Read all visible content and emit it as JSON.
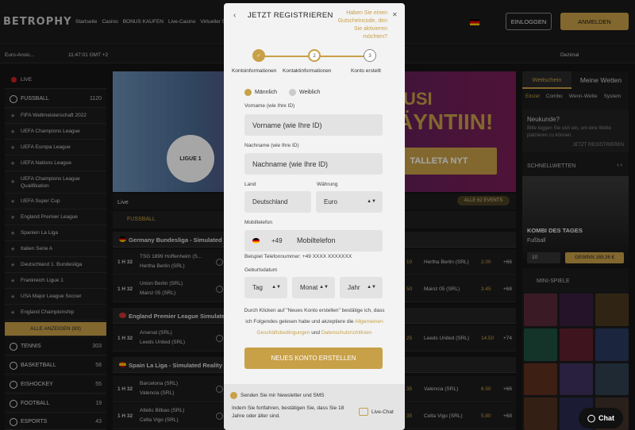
{
  "header": {
    "logo": "BETROPHY",
    "nav": [
      "Startseite",
      "Casino",
      "BONUS KAUFEN",
      "Live-Casino",
      "Virtueller Sport"
    ],
    "login_label": "EINLOGGEN",
    "register_label": "ANMELDEN"
  },
  "subbar": {
    "odds_format": "Euro-Ansic...",
    "time": "11:47:01 GMT +2",
    "decimal": "Dezimal"
  },
  "sidebar": {
    "live_label": "LIVE",
    "football": {
      "label": "FUSSBALL",
      "count": "1120"
    },
    "leagues": [
      "FIFA Weltmeisterschaft 2022",
      "UEFA Champions League",
      "UEFA Europa League",
      "UEFA Nations League",
      "UEFA Champions League Qualifikation",
      "UEFA Super Cup",
      "England Premier League",
      "Spanien La Liga",
      "Italien Serie A",
      "Deutschland 1. Bundesliga",
      "Frankreich Ligue 1",
      "USA Major League Soccer",
      "England Championship"
    ],
    "show_all": "ALLE ANZEIGEN (83)",
    "sports": [
      {
        "label": "TENNIS",
        "count": "303"
      },
      {
        "label": "BASKETBALL",
        "count": "58"
      },
      {
        "label": "EISHOCKEY",
        "count": "55"
      },
      {
        "label": "FOOTBALL",
        "count": "19"
      },
      {
        "label": "ESPORTS",
        "count": "43"
      }
    ]
  },
  "banner": {
    "line1": "USI",
    "line2": "ÄYNTIIN!",
    "button": "TALLETA NYT",
    "badge": "LIGUE 1"
  },
  "live": {
    "title": "Live",
    "all_events": "ALLE 62 EVENTS",
    "section": "FUSSBALL",
    "leagues": [
      {
        "name": "Germany Bundesliga - Simulated",
        "matches": [
          {
            "time": "1 H 32",
            "home": "TSG 1899 Hoffenheim (S...",
            "away_line": "Hertha Berlin (SRL)",
            "odd1": "10",
            "away": "Hertha Berlin (SRL)",
            "odd2": "2.00",
            "more": "+66"
          },
          {
            "time": "1 H 32",
            "home": "Union Berlin (SRL)",
            "away_line": "Mainz 05 (SRL)",
            "odd1": "50",
            "away": "Mainz 05 (SRL)",
            "odd2": "3.45",
            "more": "+68"
          }
        ]
      },
      {
        "name": "England Premier League Simulated",
        "matches": [
          {
            "time": "1 H 32",
            "home": "Arsenal (SRL)",
            "away_line": "Leeds United (SRL)",
            "odd1": "25",
            "away": "Leeds United (SRL)",
            "odd2": "14.50",
            "more": "+74"
          }
        ]
      },
      {
        "name": "Spain La Liga - Simulated Reality",
        "matches": [
          {
            "time": "1 H 32",
            "home": "Barcelona (SRL)",
            "away_line": "Valencia (SRL)",
            "odd1": "35",
            "away": "Valencia (SRL)",
            "odd2": "6.50",
            "more": "+66"
          },
          {
            "time": "1 H 32",
            "home": "Atletic Bilbao (SRL)",
            "away_line": "Celta Vigo (SRL)",
            "odd1": "35",
            "away": "Celta Vigo (SRL)",
            "odd2": "5.80",
            "more": "+68"
          }
        ]
      }
    ]
  },
  "rightpanel": {
    "tab1": "Wettschein",
    "tab2": "Meine Wetten",
    "subtabs": [
      "Einzel",
      "Combo",
      "Wenn-Wette",
      "System"
    ],
    "new_title": "Neukunde?",
    "new_text": "Bitte loggen Sie sich ein, um eine Wette platzieren zu können.",
    "new_link": "JETZT REGISTRIEREN",
    "quickbets": "SCHNELLWETTEN",
    "kombi_title": "KOMBI DES TAGES",
    "kombi_sport": "Fußball",
    "stake": "10",
    "win": "GEWINN 169,36 €",
    "mini": "MINI-SPIELE"
  },
  "chat": "Chat",
  "modal": {
    "title": "JETZT REGISTRIEREN",
    "promo": "Haben Sie einen Gutscheincode, den Sie aktivieren möchten?",
    "steps": [
      "Kontoinformationen",
      "Kontaktinformationen",
      "Konto erstellt"
    ],
    "step2_num": "2",
    "step3_num": "3",
    "gender_m": "Männlich",
    "gender_f": "Weiblich",
    "firstname_label": "Vorname (wie Ihre ID)",
    "firstname_placeholder": "Vorname (wie Ihre ID)",
    "lastname_label": "Nachname (wie Ihre ID)",
    "lastname_placeholder": "Nachname (wie Ihre ID)",
    "country_label": "Land",
    "country_value": "Deutschland",
    "currency_label": "Währung",
    "currency_value": "Euro",
    "phone_label": "Mobiltelefon",
    "phone_code": "+49",
    "phone_placeholder": "Mobiltelefon",
    "phone_hint": "Beispiel Telefonnummer: +49 XXXX XXXXXXX",
    "dob_label": "Geburtsdatum",
    "day": "Tag",
    "month": "Monat",
    "year": "Jahr",
    "terms_pre": "Durch Klicken auf \"Neues Konto erstellen\" bestätige ich, dass ich Folgendes gelesen habe und akzeptiere die ",
    "terms_link": "Allgemeinen Geschäftsbedingungen",
    "terms_and": " und ",
    "privacy_link": "Datenschutzrichtlinien",
    "create_button": "NEUES KONTO ERSTELLEN",
    "newsletter": "Senden Sie mir Newsletter und SMS",
    "agree": "Indem Sie fortfahren, bestätigen Sie, dass Sie 18 Jahre oder älter sind.",
    "livechat": "Live-Chat"
  },
  "colors": {
    "accent": "#c8a047",
    "background": "#141414",
    "modal": "#f3f3f3"
  }
}
